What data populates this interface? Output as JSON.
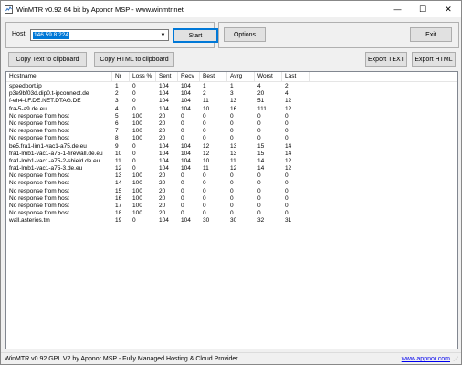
{
  "window": {
    "title": "WinMTR v0.92 64 bit by Appnor MSP - www.winmtr.net",
    "controls": {
      "minimize": "—",
      "maximize": "☐",
      "close": "✕"
    }
  },
  "host": {
    "label": "Host:",
    "value": "146.59.8.224",
    "start_label": "Start"
  },
  "options": {
    "options_label": "Options",
    "exit_label": "Exit"
  },
  "actions": {
    "copy_text_label": "Copy Text to clipboard",
    "copy_html_label": "Copy HTML to clipboard",
    "export_text_label": "Export TEXT",
    "export_html_label": "Export HTML"
  },
  "table": {
    "columns": [
      "Hostname",
      "Nr",
      "Loss %",
      "Sent",
      "Recv",
      "Best",
      "Avrg",
      "Worst",
      "Last"
    ],
    "rows": [
      [
        "speedport.ip",
        "1",
        "0",
        "104",
        "104",
        "1",
        "1",
        "4",
        "2"
      ],
      [
        "p3e9bf03d.dip0.t-ipconnect.de",
        "2",
        "0",
        "104",
        "104",
        "2",
        "3",
        "20",
        "4"
      ],
      [
        "f-eh4-i.F.DE.NET.DTAG.DE",
        "3",
        "0",
        "104",
        "104",
        "11",
        "13",
        "51",
        "12"
      ],
      [
        "fra-5-a9.de.eu",
        "4",
        "0",
        "104",
        "104",
        "10",
        "16",
        "111",
        "12"
      ],
      [
        "No response from host",
        "5",
        "100",
        "20",
        "0",
        "0",
        "0",
        "0",
        "0"
      ],
      [
        "No response from host",
        "6",
        "100",
        "20",
        "0",
        "0",
        "0",
        "0",
        "0"
      ],
      [
        "No response from host",
        "7",
        "100",
        "20",
        "0",
        "0",
        "0",
        "0",
        "0"
      ],
      [
        "No response from host",
        "8",
        "100",
        "20",
        "0",
        "0",
        "0",
        "0",
        "0"
      ],
      [
        "be5.fra1-lim1-vac1-a75.de.eu",
        "9",
        "0",
        "104",
        "104",
        "12",
        "13",
        "15",
        "14"
      ],
      [
        "fra1-lmb1-vac1-a75-1-firewall.de.eu",
        "10",
        "0",
        "104",
        "104",
        "12",
        "13",
        "15",
        "14"
      ],
      [
        "fra1-lmb1-vac1-a75-2-shield.de.eu",
        "11",
        "0",
        "104",
        "104",
        "10",
        "11",
        "14",
        "12"
      ],
      [
        "fra1-lmb1-vac1-a75-3.de.eu",
        "12",
        "0",
        "104",
        "104",
        "11",
        "12",
        "14",
        "12"
      ],
      [
        "No response from host",
        "13",
        "100",
        "20",
        "0",
        "0",
        "0",
        "0",
        "0"
      ],
      [
        "No response from host",
        "14",
        "100",
        "20",
        "0",
        "0",
        "0",
        "0",
        "0"
      ],
      [
        "No response from host",
        "15",
        "100",
        "20",
        "0",
        "0",
        "0",
        "0",
        "0"
      ],
      [
        "No response from host",
        "16",
        "100",
        "20",
        "0",
        "0",
        "0",
        "0",
        "0"
      ],
      [
        "No response from host",
        "17",
        "100",
        "20",
        "0",
        "0",
        "0",
        "0",
        "0"
      ],
      [
        "No response from host",
        "18",
        "100",
        "20",
        "0",
        "0",
        "0",
        "0",
        "0"
      ],
      [
        "wall.asterios.tm",
        "19",
        "0",
        "104",
        "104",
        "30",
        "30",
        "32",
        "31"
      ]
    ]
  },
  "status": {
    "text": "WinMTR v0.92 GPL V2 by Appnor MSP - Fully Managed Hosting & Cloud Provider",
    "link": "www.appnor.com"
  },
  "colors": {
    "selection": "#0078d7",
    "link": "#0000ee"
  }
}
